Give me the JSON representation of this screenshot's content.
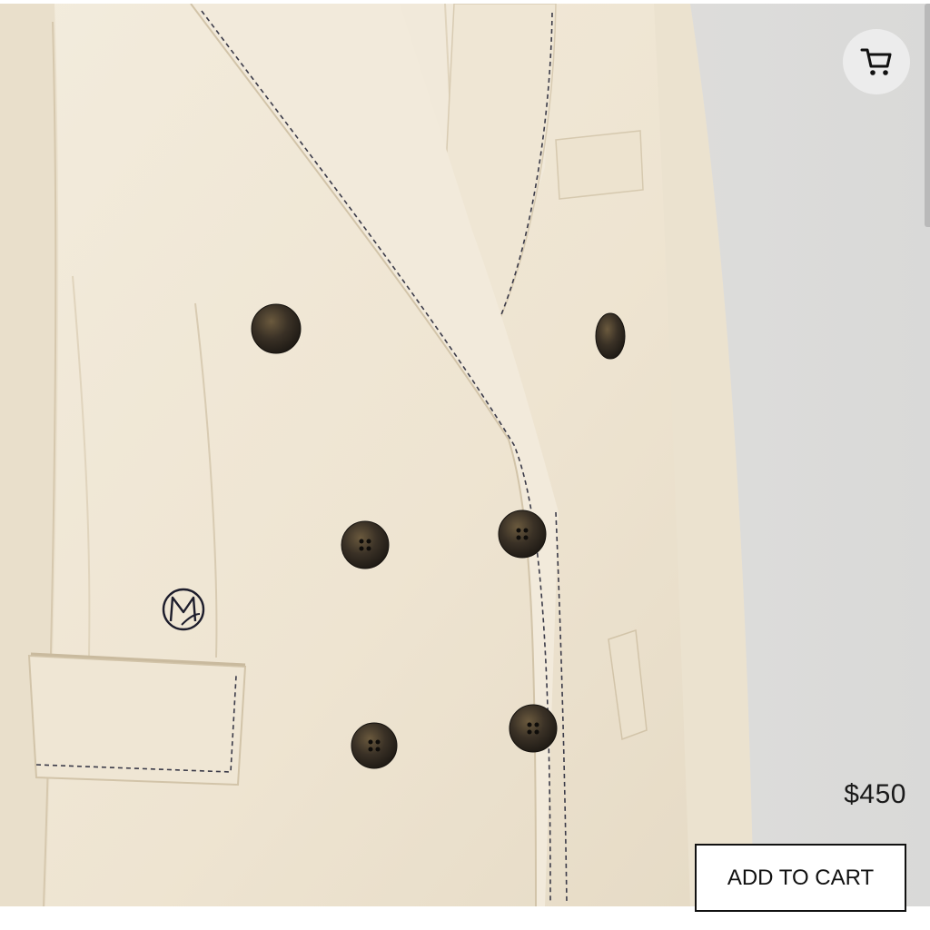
{
  "product": {
    "image_alt": "Cream double-breasted blazer with tortoiseshell buttons and contrast stitching",
    "logo_lettering": "M",
    "price": "$450",
    "add_to_cart_label": "ADD TO CART"
  },
  "header": {
    "cart_icon": "shopping-cart-icon"
  },
  "colors": {
    "fabric": "#efe6d4",
    "stitching": "#3a3a48",
    "buttons": "#2f2a22",
    "background": "#e4e3df",
    "cart_button_bg": "#ececec",
    "text": "#111111"
  }
}
